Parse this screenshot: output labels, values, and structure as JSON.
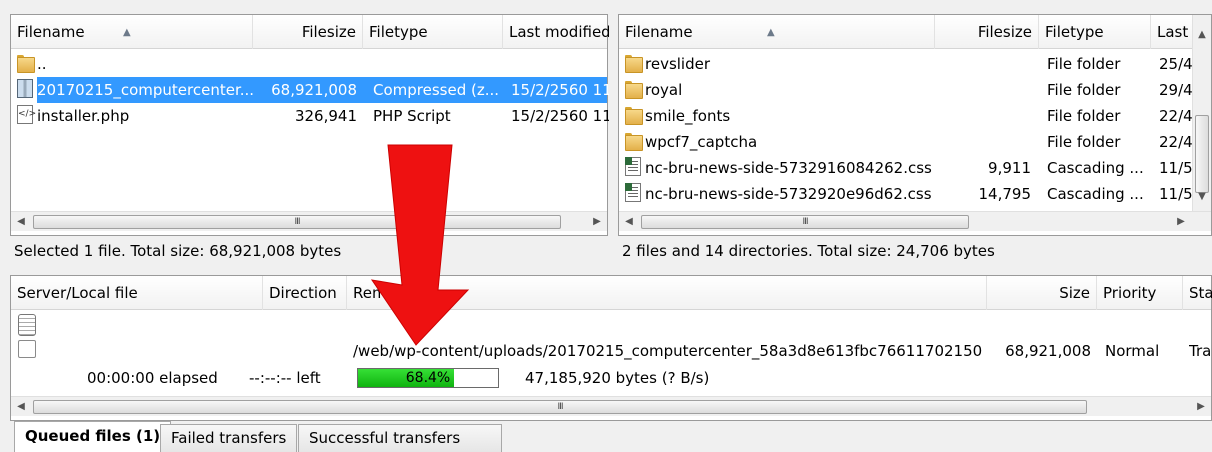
{
  "local_pane": {
    "columns": {
      "filename": "Filename",
      "filesize": "Filesize",
      "filetype": "Filetype",
      "last_modified": "Last modified"
    },
    "rows": [
      {
        "name": "..",
        "size": "",
        "type": "",
        "modified": "",
        "icon": "folder-icon"
      },
      {
        "name": "20170215_computercenter...",
        "size": "68,921,008",
        "type": "Compressed (z...",
        "modified": "15/2/2560 11",
        "icon": "zip-file-icon",
        "selected": true
      },
      {
        "name": "installer.php",
        "size": "326,941",
        "type": "PHP Script",
        "modified": "15/2/2560 11",
        "icon": "php-file-icon"
      }
    ],
    "scroll_grip": "III",
    "status": "Selected 1 file. Total size: 68,921,008 bytes"
  },
  "remote_pane": {
    "columns": {
      "filename": "Filename",
      "filesize": "Filesize",
      "filetype": "Filetype",
      "last_modified": "Last"
    },
    "rows": [
      {
        "name": "revslider",
        "size": "",
        "type": "File folder",
        "modified": "25/4",
        "icon": "folder-icon"
      },
      {
        "name": "royal",
        "size": "",
        "type": "File folder",
        "modified": "29/4",
        "icon": "folder-icon"
      },
      {
        "name": "smile_fonts",
        "size": "",
        "type": "File folder",
        "modified": "22/4",
        "icon": "folder-icon"
      },
      {
        "name": "wpcf7_captcha",
        "size": "",
        "type": "File folder",
        "modified": "22/4",
        "icon": "folder-icon"
      },
      {
        "name": "nc-bru-news-side-5732916084262.css",
        "size": "9,911",
        "type": "Cascading ...",
        "modified": "11/5",
        "icon": "css-file-icon"
      },
      {
        "name": "nc-bru-news-side-5732920e96d62.css",
        "size": "14,795",
        "type": "Cascading ...",
        "modified": "11/5",
        "icon": "css-file-icon"
      }
    ],
    "scroll_grip": "III",
    "status": "2 files and 14 directories. Total size: 24,706 bytes"
  },
  "queue": {
    "columns": {
      "server_local": "Server/Local file",
      "direction": "Direction",
      "remote": "Remo",
      "size": "Size",
      "priority": "Priority",
      "status": "Sta"
    },
    "transfer": {
      "remote_path": "/web/wp-content/uploads/20170215_computercenter_58a3d8e613fbc76611702150...",
      "size": "68,921,008",
      "priority": "Normal",
      "status": "Tra",
      "elapsed": "00:00:00 elapsed",
      "left": "--:--:-- left",
      "progress_percent": 68.4,
      "progress_label": "68.4%",
      "bytes": "47,185,920 bytes (? B/s)"
    },
    "scroll_grip": "III"
  },
  "tabs": [
    {
      "label": "Queued files (1)",
      "active": true
    },
    {
      "label": "Failed transfers",
      "active": false
    },
    {
      "label": "Successful transfers",
      "active": false
    }
  ],
  "colors": {
    "selection": "#3399ff",
    "progress": "#1ec81e",
    "arrow": "#ee1111"
  }
}
